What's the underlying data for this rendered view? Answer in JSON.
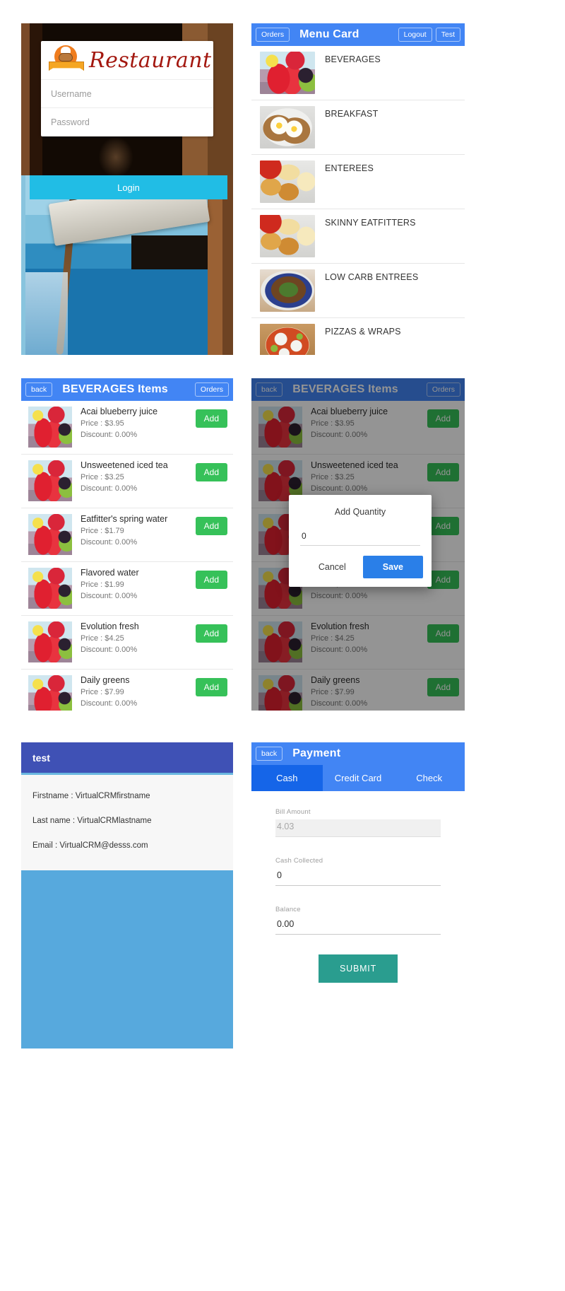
{
  "login": {
    "brand_name": "Restaurant",
    "logo_icon": "chef-ribbon-logo",
    "username_placeholder": "Username",
    "password_placeholder": "Password",
    "login_label": "Login"
  },
  "menu_card": {
    "orders_label": "Orders",
    "title": "Menu Card",
    "logout_label": "Logout",
    "test_label": "Test",
    "items": [
      {
        "label": "BEVERAGES",
        "thumb": "t-beverage"
      },
      {
        "label": "BREAKFAST",
        "thumb": "t-breakfast"
      },
      {
        "label": "ENTEREES",
        "thumb": "t-enterees"
      },
      {
        "label": "SKINNY EATFITTERS",
        "thumb": "t-enterees"
      },
      {
        "label": "LOW CARB ENTREES",
        "thumb": "t-lowcarb"
      },
      {
        "label": "PIZZAS & WRAPS",
        "thumb": "t-pizza"
      }
    ]
  },
  "items_page": {
    "back_label": "back",
    "title": "BEVERAGES Items",
    "orders_label": "Orders",
    "add_label": "Add",
    "items": [
      {
        "name": "Acai blueberry juice",
        "price": "Price : $3.95",
        "discount": "Discount: 0.00%"
      },
      {
        "name": "Unsweetened iced tea",
        "price": "Price : $3.25",
        "discount": "Discount: 0.00%"
      },
      {
        "name": "Eatfitter's spring water",
        "price": "Price : $1.79",
        "discount": "Discount: 0.00%"
      },
      {
        "name": "Flavored water",
        "price": "Price : $1.99",
        "discount": "Discount: 0.00%"
      },
      {
        "name": "Evolution fresh",
        "price": "Price : $4.25",
        "discount": "Discount: 0.00%"
      },
      {
        "name": "Daily greens",
        "price": "Price : $7.99",
        "discount": "Discount: 0.00%"
      }
    ]
  },
  "quantity_dialog": {
    "title": "Add Quantity",
    "value": "0",
    "cancel_label": "Cancel",
    "save_label": "Save"
  },
  "test_page": {
    "title": "test",
    "firstname": "Firstname : VirtualCRMfirstname",
    "lastname": "Last name : VirtualCRMlastname",
    "email": "Email : VirtualCRM@desss.com"
  },
  "payment": {
    "back_label": "back",
    "title": "Payment",
    "tabs": [
      {
        "label": "Cash",
        "active": true
      },
      {
        "label": "Credit Card",
        "active": false
      },
      {
        "label": "Check",
        "active": false
      }
    ],
    "bill_amount_label": "Bill Amount",
    "bill_amount_value": "4.03",
    "cash_collected_label": "Cash Collected",
    "cash_collected_value": "0",
    "balance_label": "Balance",
    "balance_value": "0.00",
    "submit_label": "SUBMIT"
  },
  "colors": {
    "primary_blue": "#4285f4",
    "tab_active_blue": "#1565e8",
    "login_cyan": "#21bde5",
    "add_green": "#36c159",
    "submit_teal": "#2a9d8f",
    "indigo": "#3f51b5",
    "brand_red": "#a3170f"
  }
}
